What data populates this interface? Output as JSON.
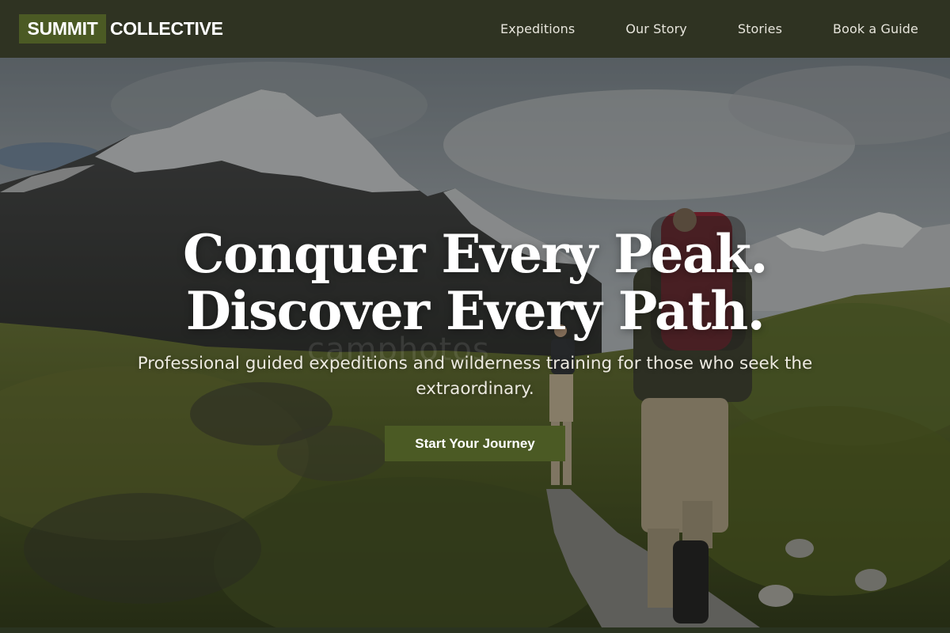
{
  "brand": {
    "name_box": "SUMMIT",
    "name_rest": "COLLECTIVE"
  },
  "nav": {
    "items": [
      {
        "label": "Expeditions"
      },
      {
        "label": "Our Story"
      },
      {
        "label": "Stories"
      },
      {
        "label": "Book a Guide"
      }
    ]
  },
  "hero": {
    "title_line1": "Conquer Every Peak.",
    "title_line2": "Discover Every Path.",
    "subtitle": "Professional guided expeditions and wilderness training for those who seek the extraordinary.",
    "cta_label": "Start Your Journey",
    "watermark": "camphotos"
  },
  "colors": {
    "header_bg": "#2f3322",
    "brand_accent": "#4b5a24",
    "text_light": "#ffffff"
  },
  "icons": {}
}
